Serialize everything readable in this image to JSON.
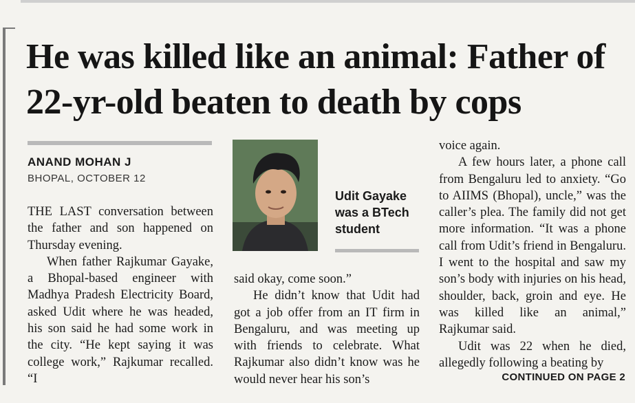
{
  "article": {
    "headline": "He was killed like an animal: Father of 22-yr-old beaten to death by cops",
    "author": "ANAND MOHAN J",
    "dateline": "BHOPAL, OCTOBER 12",
    "photo_caption": "Udit Gayake was a BTech student",
    "col1": {
      "p1": "THE LAST conversation between the father and son happened on Thursday evening.",
      "p2": "When father Rajkumar Gayake, a Bhopal-based engineer with Madhya Pradesh Electricity Board, asked Udit where he was headed, his son said he had some work in the city. “He kept saying it was college work,” Rajkumar recalled. “I"
    },
    "col2": {
      "p1": "said okay, come soon.”",
      "p2": "He didn’t know that Udit had got a job offer from an IT firm in Bengaluru, and was meeting up with friends to celebrate. What Rajkumar also didn’t know was he would never hear his son’s"
    },
    "col3": {
      "p1": "voice again.",
      "p2": "A few hours later, a phone call from Bengaluru led to anxiety. “Go to AIIMS (Bhopal), uncle,” was the caller’s plea. The family did not get more information. “It was a phone call from Udit’s friend in Bengaluru. I went to the hospital and saw my son’s body with injuries on his head, shoulder, back, groin and eye. He was killed like an animal,” Rajkumar said.",
      "p3": "Udit was 22 when he died, allegedly following a beating by"
    },
    "continued": "CONTINUED ON PAGE 2"
  }
}
